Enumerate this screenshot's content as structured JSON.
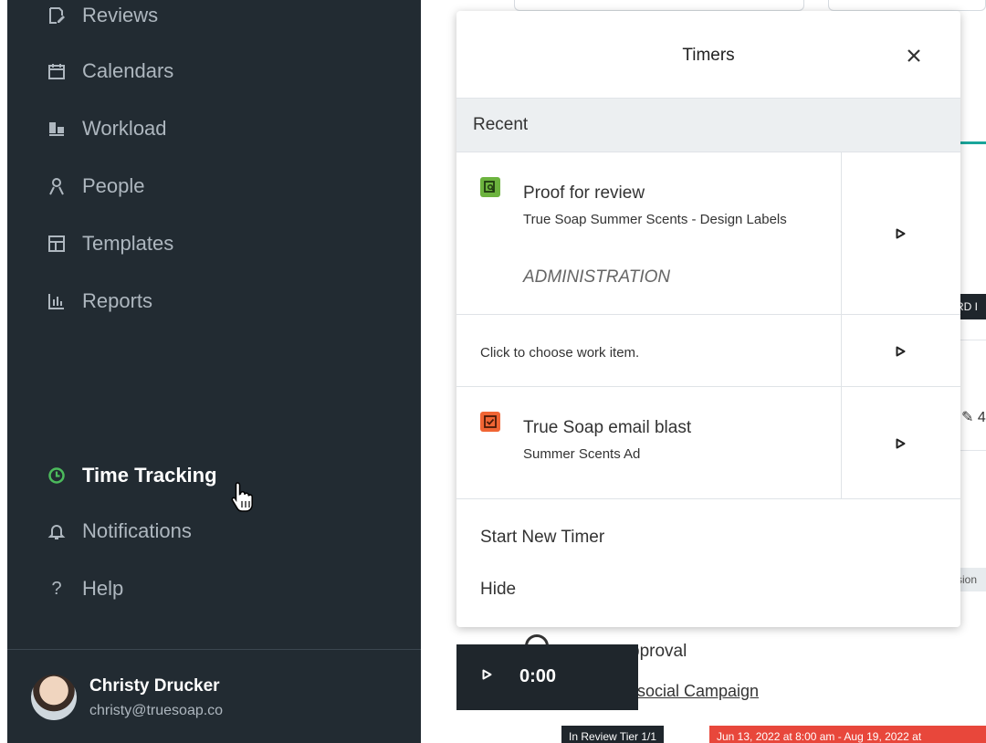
{
  "sidebar": {
    "items": [
      {
        "label": "Reviews",
        "icon": "reviews-icon"
      },
      {
        "label": "Calendars",
        "icon": "calendar-icon"
      },
      {
        "label": "Workload",
        "icon": "workload-icon"
      },
      {
        "label": "People",
        "icon": "person-icon"
      },
      {
        "label": "Templates",
        "icon": "templates-icon"
      },
      {
        "label": "Reports",
        "icon": "reports-icon"
      },
      {
        "label": "Time Tracking",
        "icon": "clock-icon",
        "active": true
      },
      {
        "label": "Notifications",
        "icon": "bell-icon"
      },
      {
        "label": "Help",
        "icon": "help-icon"
      }
    ],
    "user": {
      "name": "Christy Drucker",
      "email": "christy@truesoap.co"
    }
  },
  "timers": {
    "title": "Timers",
    "recent_label": "Recent",
    "rows": [
      {
        "title": "Proof for review",
        "subtitle": "True Soap Summer Scents - Design Labels",
        "category": "ADMINISTRATION",
        "icon": "proof-icon",
        "icon_color": "#6cb33e"
      },
      {
        "placeholder": "Click to choose work item."
      },
      {
        "title": "True Soap email blast",
        "subtitle": "Summer Scents Ad",
        "icon": "task-icon",
        "icon_color": "#f06534"
      }
    ],
    "start_new_label": "Start New Timer",
    "hide_label": "Hide"
  },
  "mini_timer": {
    "time": "0:00"
  },
  "background": {
    "approval_text": "pproval",
    "campaign_text": "social Campaign",
    "badge_text": "In Review   Tier 1/1",
    "date_text": "Jun 13, 2022 at 8:00 am - Aug 19, 2022 at",
    "chip_text": "RD I",
    "edge_text": "✎ 4",
    "version_text": "rsion"
  },
  "colors": {
    "sidebar_bg": "#222b32",
    "active_icon": "#4cbb5c",
    "accent_teal": "#1aa59a",
    "date_red": "#e8473b"
  }
}
